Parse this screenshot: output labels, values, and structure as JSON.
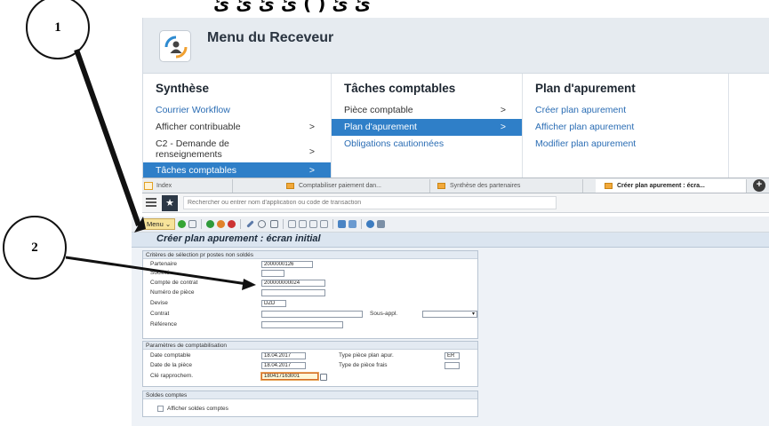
{
  "overlay_text": "ئ  ئ  (  )  ئ  ئ  ئ  ئ",
  "callouts": [
    "1",
    "2"
  ],
  "launchpad": {
    "title": "Menu du Receveur",
    "columns": [
      {
        "heading": "Synthèse",
        "items": [
          {
            "label": "Courrier Workflow",
            "style": "link"
          },
          {
            "label": "Afficher contribuable",
            "style": "normal",
            "arrow": ">"
          },
          {
            "label": "C2 - Demande de renseignements",
            "style": "normal",
            "arrow": ">"
          },
          {
            "label": "Tâches comptables",
            "style": "selected",
            "arrow": ">"
          }
        ]
      },
      {
        "heading": "Tâches comptables",
        "items": [
          {
            "label": "Pièce comptable",
            "style": "normal",
            "arrow": ">"
          },
          {
            "label": "Plan d'apurement",
            "style": "selected",
            "arrow": ">"
          },
          {
            "label": "Obligations cautionnées",
            "style": "link"
          }
        ]
      },
      {
        "heading": "Plan d'apurement",
        "items": [
          {
            "label": "Créer plan apurement",
            "style": "link"
          },
          {
            "label": "Afficher plan apurement",
            "style": "link"
          },
          {
            "label": "Modifier plan apurement",
            "style": "link"
          }
        ]
      }
    ]
  },
  "tabs": [
    {
      "label": "Index"
    },
    {
      "label": "Comptabiliser paiement dan..."
    },
    {
      "label": "Synthèse des partenaires"
    },
    {
      "label": "Créer plan apurement : écra...",
      "active": true
    }
  ],
  "tab_add_glyph": "+",
  "search_placeholder": "Rechercher ou entrer nom d'application ou code de transaction",
  "toolbar": {
    "menu_label": "Menu",
    "menu_caret": "⌄"
  },
  "screen_title": "Créer plan apurement : écran initial",
  "groups": {
    "selection": {
      "title": "Critères de sélection pr postes non soldés",
      "partenaire_label": "Partenaire",
      "partenaire_value": "2000000126",
      "societe_label": "Société",
      "societe_value": "",
      "compte_label": "Compte de contrat",
      "compte_value": "200000000024",
      "piece_label": "Numéro de pièce",
      "piece_value": "",
      "devise_label": "Devise",
      "devise_value": "DZD",
      "contrat_label": "Contrat",
      "contrat_value": "",
      "sousappl_label": "Sous-appl.",
      "sousappl_value": "",
      "reference_label": "Référence",
      "reference_value": ""
    },
    "posting": {
      "title": "Paramètres de comptabilisation",
      "date_comptable_label": "Date comptable",
      "date_comptable_value": "18.04.2017",
      "type_piece_label": "Type pièce plan apur.",
      "type_piece_value": "ER",
      "date_piece_label": "Date de la pièce",
      "date_piece_value": "18.04.2017",
      "type_frais_label": "Type de pièce frais",
      "type_frais_value": "",
      "cle_label": "Clé rapprochem.",
      "cle_value": "180417163001"
    },
    "balances": {
      "title": "Soldes comptes",
      "checkbox_label": "Afficher soldes comptes"
    }
  },
  "colors": {
    "selected_blue": "#2f7fc8",
    "link_blue": "#2b6db4",
    "title_bar": "#dbe5f0",
    "highlight_orange": "#d36b2a"
  }
}
